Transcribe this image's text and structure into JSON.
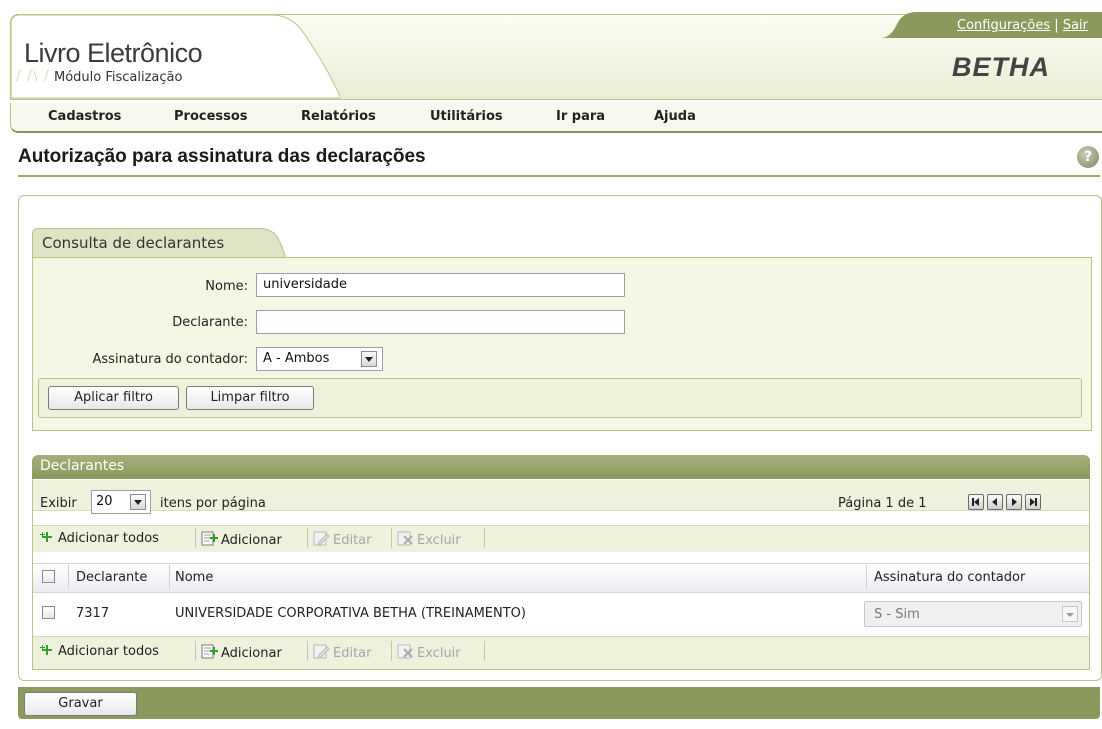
{
  "header": {
    "app_title": "Livro Eletrônico",
    "app_subtitle": "Módulo Fiscalização",
    "link_config": "Configurações",
    "link_separator": "|",
    "link_logout": "Sair",
    "brand": "BETHA"
  },
  "menu": {
    "items": [
      "Cadastros",
      "Processos",
      "Relatórios",
      "Utilitários",
      "Ir para",
      "Ajuda"
    ]
  },
  "page": {
    "title": "Autorização para assinatura das declarações",
    "help_glyph": "?"
  },
  "filter": {
    "tab_label": "Consulta de declarantes",
    "nome_label": "Nome:",
    "nome_value": "universidade",
    "declarante_label": "Declarante:",
    "declarante_value": "",
    "assinatura_label": "Assinatura do contador:",
    "assinatura_value": "A - Ambos",
    "apply_button": "Aplicar filtro",
    "clear_button": "Limpar filtro"
  },
  "declarantes": {
    "panel_title": "Declarantes",
    "show_label": "Exibir",
    "page_size": "20",
    "per_page_label": "itens por página",
    "page_info": "Página 1 de 1",
    "toolbar": {
      "add_all": "Adicionar todos",
      "add": "Adicionar",
      "edit": "Editar",
      "delete": "Excluir"
    },
    "columns": [
      "Declarante",
      "Nome",
      "Assinatura do contador"
    ],
    "rows": [
      {
        "declarante": "7317",
        "nome": "UNIVERSIDADE CORPORATIVA BETHA (TREINAMENTO)",
        "assinatura": "S - Sim"
      }
    ]
  },
  "footer": {
    "save_button": "Gravar"
  },
  "colors": {
    "accent_olive": "#8b995c",
    "panel_bg": "#f5f7e4",
    "add_icon_green": "#2f9e2f"
  }
}
